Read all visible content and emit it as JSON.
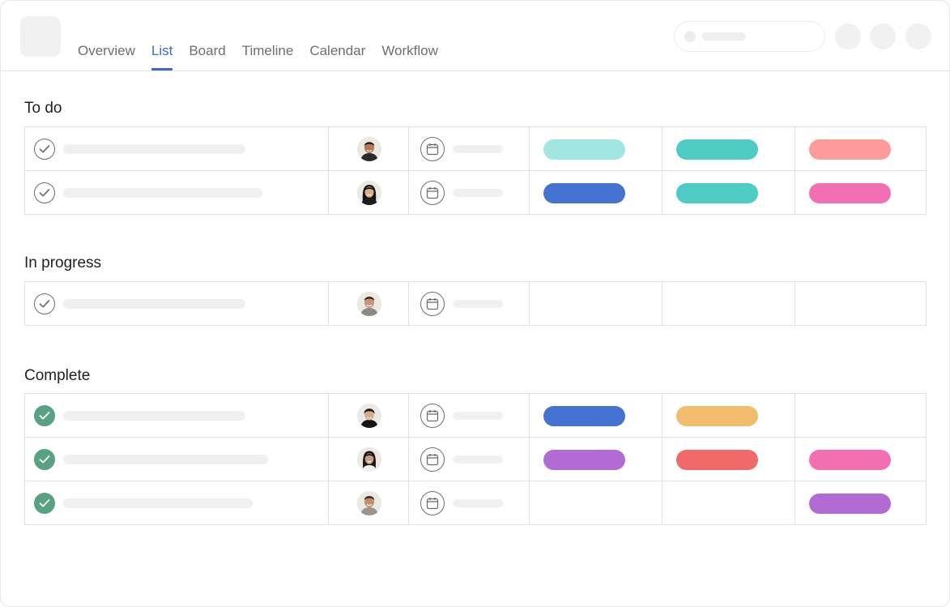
{
  "header": {
    "tabs": [
      {
        "label": "Overview",
        "active": false
      },
      {
        "label": "List",
        "active": true
      },
      {
        "label": "Board",
        "active": false
      },
      {
        "label": "Timeline",
        "active": false
      },
      {
        "label": "Calendar",
        "active": false
      },
      {
        "label": "Workflow",
        "active": false
      }
    ]
  },
  "colors": {
    "accent": "#3f6ac4",
    "complete_check": "#58a182",
    "tag_aqua_light": "#a1e6e1",
    "tag_teal": "#4fcbc4",
    "tag_salmon": "#fd9a9a",
    "tag_blue": "#4573d2",
    "tag_pink": "#f26fb2",
    "tag_yellow": "#f1bd6c",
    "tag_purple": "#b36bd4",
    "tag_red": "#f06a6a"
  },
  "sections": [
    {
      "title": "To do",
      "rows": [
        {
          "complete": false,
          "assignee": "avatar-man-1",
          "tags": [
            "#a1e6e1",
            "#4fcbc4",
            "#fd9a9a"
          ]
        },
        {
          "complete": false,
          "assignee": "avatar-woman-1",
          "tags": [
            "#4573d2",
            "#4fcbc4",
            "#f26fb2"
          ]
        }
      ]
    },
    {
      "title": "In progress",
      "rows": [
        {
          "complete": false,
          "assignee": "avatar-man-2",
          "tags": [
            null,
            null,
            null
          ]
        }
      ]
    },
    {
      "title": "Complete",
      "rows": [
        {
          "complete": true,
          "assignee": "avatar-woman-2",
          "tags": [
            "#4573d2",
            "#f1bd6c",
            null
          ]
        },
        {
          "complete": true,
          "assignee": "avatar-woman-3",
          "tags": [
            "#b36bd4",
            "#f06a6a",
            "#f26fb2"
          ]
        },
        {
          "complete": true,
          "assignee": "avatar-man-3",
          "tags": [
            null,
            null,
            "#b36bd4"
          ]
        }
      ]
    }
  ]
}
